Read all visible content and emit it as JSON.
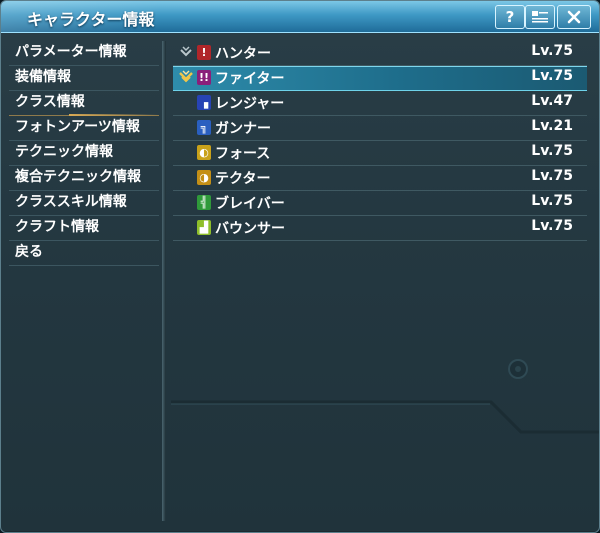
{
  "window": {
    "title": "キャラクター情報"
  },
  "titlebar_buttons": {
    "help": "?",
    "close_icon": "close-icon",
    "menu_icon": "menu-icon"
  },
  "sidebar": {
    "items": [
      {
        "label": "パラメーター情報"
      },
      {
        "label": "装備情報"
      },
      {
        "label": "クラス情報",
        "active": true
      },
      {
        "label": "フォトンアーツ情報"
      },
      {
        "label": "テクニック情報"
      },
      {
        "label": "複合テクニック情報"
      },
      {
        "label": "クラススキル情報"
      },
      {
        "label": "クラフト情報"
      },
      {
        "label": "戻る"
      }
    ]
  },
  "classes": [
    {
      "name": "ハンター",
      "level": "Lv.75",
      "icon": "hunter-icon",
      "icon_color": "#b0262a",
      "marker": "sub-class-marker"
    },
    {
      "name": "ファイター",
      "level": "Lv.75",
      "icon": "fighter-icon",
      "icon_color": "#8a1f7a",
      "marker": "main-class-marker",
      "selected": true
    },
    {
      "name": "レンジャー",
      "level": "Lv.47",
      "icon": "ranger-icon",
      "icon_color": "#2743b5"
    },
    {
      "name": "ガンナー",
      "level": "Lv.21",
      "icon": "gunner-icon",
      "icon_color": "#2a5fc0"
    },
    {
      "name": "フォース",
      "level": "Lv.75",
      "icon": "force-icon",
      "icon_color": "#c9a21a"
    },
    {
      "name": "テクター",
      "level": "Lv.75",
      "icon": "techer-icon",
      "icon_color": "#c48f16"
    },
    {
      "name": "ブレイバー",
      "level": "Lv.75",
      "icon": "braver-icon",
      "icon_color": "#2f9a3a"
    },
    {
      "name": "バウンサー",
      "level": "Lv.75",
      "icon": "bouncer-icon",
      "icon_color": "#8fbf2a"
    }
  ],
  "colors": {
    "titlebar": "#3e98c4",
    "selected_row": "#2e8cab",
    "panel": "#243841",
    "active_underline": "#d9aa55"
  }
}
